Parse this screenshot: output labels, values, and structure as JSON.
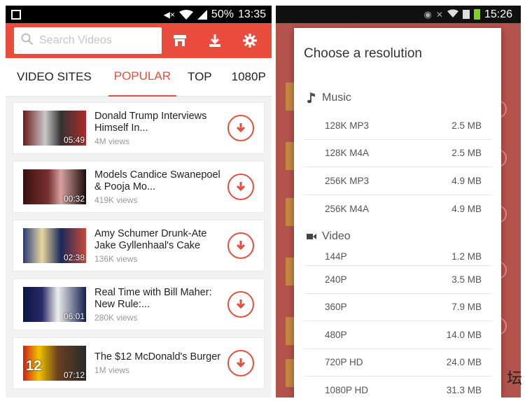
{
  "left_status": {
    "battery": "50%",
    "time": "13:35"
  },
  "search": {
    "placeholder": "Search Videos"
  },
  "tabs": [
    {
      "label": "VIDEO SITES"
    },
    {
      "label": "POPULAR"
    },
    {
      "label": "TOP"
    },
    {
      "label": "1080P"
    }
  ],
  "videos": [
    {
      "title": "Donald Trump Interviews Himself In...",
      "views": "4M views",
      "duration": "05:49"
    },
    {
      "title": "Models Candice Swanepoel & Pooja Mo...",
      "views": "419K views",
      "duration": "00:32"
    },
    {
      "title": "Amy Schumer Drunk-Ate Jake Gyllenhaal's Cake",
      "views": "136K views",
      "duration": "02:38"
    },
    {
      "title": "Real Time with Bill Maher: New Rule:...",
      "views": "280K views",
      "duration": "06:01"
    },
    {
      "title": "The $12 McDonald's Burger",
      "views": "1M views",
      "duration": "07:12"
    }
  ],
  "thumb_overlay_number": "12",
  "right_status": {
    "time": "15:26"
  },
  "dialog": {
    "title": "Choose a resolution",
    "music_label": "Music",
    "video_label": "Video",
    "music": [
      {
        "label": "128K MP3",
        "size": "2.5 MB"
      },
      {
        "label": "128K M4A",
        "size": "2.5 MB"
      },
      {
        "label": "256K MP3",
        "size": "4.9 MB"
      },
      {
        "label": "256K M4A",
        "size": "4.9 MB"
      }
    ],
    "video": [
      {
        "label": "144P",
        "size": "1.2 MB"
      },
      {
        "label": "240P",
        "size": "3.5 MB"
      },
      {
        "label": "360P",
        "size": "7.9 MB"
      },
      {
        "label": "480P",
        "size": "14.0 MB"
      },
      {
        "label": "720P HD",
        "size": "24.0 MB"
      },
      {
        "label": "1080P HD",
        "size": "31.3 MB"
      }
    ]
  },
  "watermark": "坛",
  "colors": {
    "accent": "#e94c3d"
  }
}
